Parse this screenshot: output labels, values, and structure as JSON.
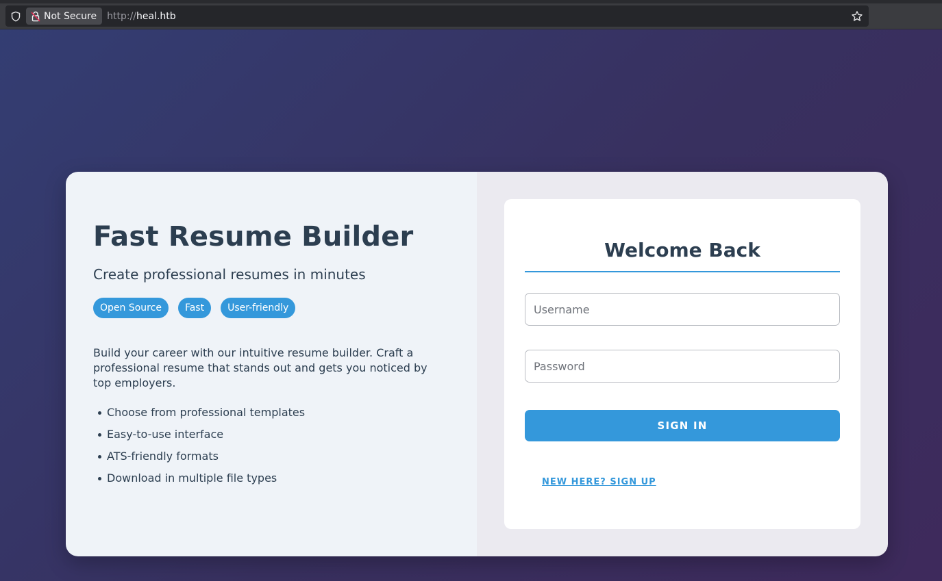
{
  "browser": {
    "security_label": "Not Secure",
    "url_protocol": "http://",
    "url_host": "heal.htb"
  },
  "hero": {
    "title": "Fast Resume Builder",
    "subtitle": "Create professional resumes in minutes",
    "tags": [
      "Open Source",
      "Fast",
      "User-friendly"
    ],
    "description": "Build your career with our intuitive resume builder. Craft a professional resume that stands out and gets you noticed by top employers.",
    "features": [
      "Choose from professional templates",
      "Easy-to-use interface",
      "ATS-friendly formats",
      "Download in multiple file types"
    ]
  },
  "login": {
    "heading": "Welcome Back",
    "username_placeholder": "Username",
    "password_placeholder": "Password",
    "signin_label": "SIGN IN",
    "signup_label": "NEW HERE? SIGN UP"
  },
  "colors": {
    "accent": "#3498db",
    "text_dark": "#2c3e50"
  }
}
